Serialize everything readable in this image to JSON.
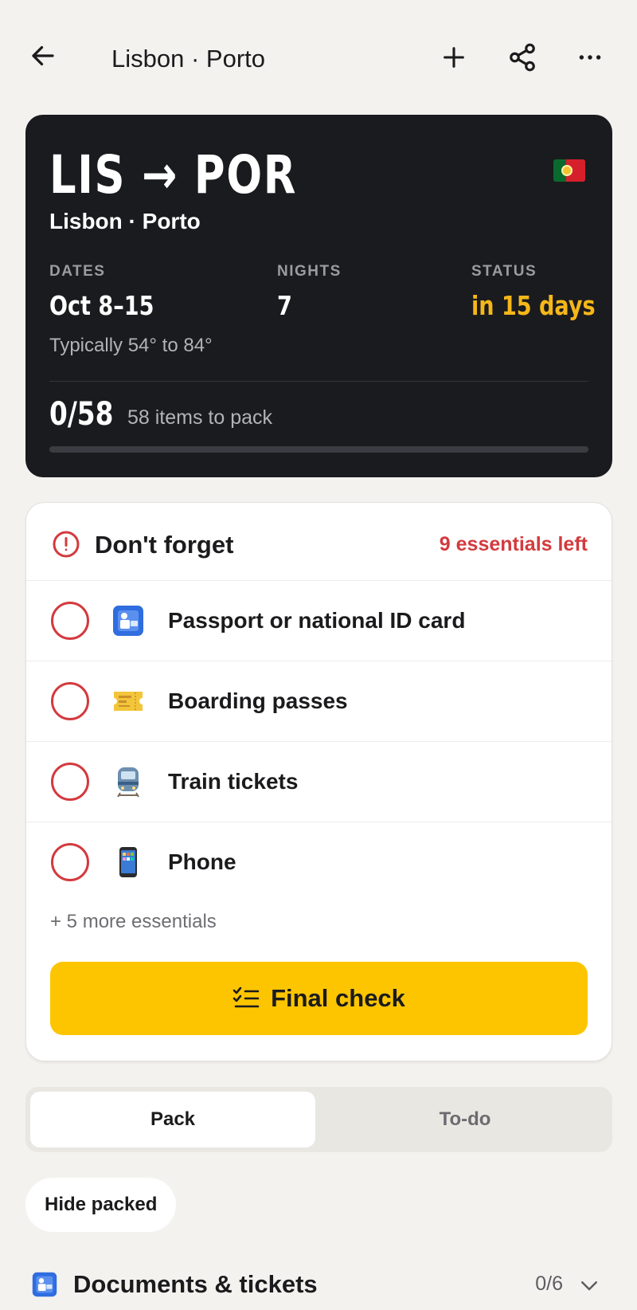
{
  "topbar": {
    "title": "Lisbon · Porto",
    "back_icon": "arrow-left-icon",
    "actions": [
      "plus-icon",
      "share-icon",
      "more-horizontal-icon"
    ]
  },
  "hero": {
    "route": "LIS → POR",
    "subtitle": "Lisbon · Porto",
    "flag": "portugal-flag-icon",
    "stats": [
      {
        "label": "DATES",
        "value": "Oct 8–15"
      },
      {
        "label": "NIGHTS",
        "value": "7"
      },
      {
        "label": "STATUS",
        "value": "in 15 days"
      }
    ],
    "weather": "Typically 54° to 84°",
    "packed_count": "0/58",
    "packed_label": "58 items to pack",
    "progress": 0,
    "status_color": "#f5b719"
  },
  "essentials": {
    "title": "Don't forget",
    "left_label": "9 essentials left",
    "accent_color": "#d33a3e",
    "items": [
      {
        "label": "Passport or national ID card",
        "icon": "passport-control-icon"
      },
      {
        "label": "Boarding passes",
        "icon": "ticket-icon"
      },
      {
        "label": "Train tickets",
        "icon": "train-icon"
      },
      {
        "label": "Phone",
        "icon": "mobile-phone-icon"
      }
    ],
    "more_label": "+ 5 more essentials",
    "final_check_label": "Final check",
    "final_check_color": "#fdc500"
  },
  "tabs": {
    "pack": "Pack",
    "todo": "To-do",
    "active": "Pack"
  },
  "filter": {
    "hide_packed": "Hide packed"
  },
  "section": {
    "title": "Documents & tickets",
    "count": "0/6",
    "icon": "passport-control-icon"
  }
}
